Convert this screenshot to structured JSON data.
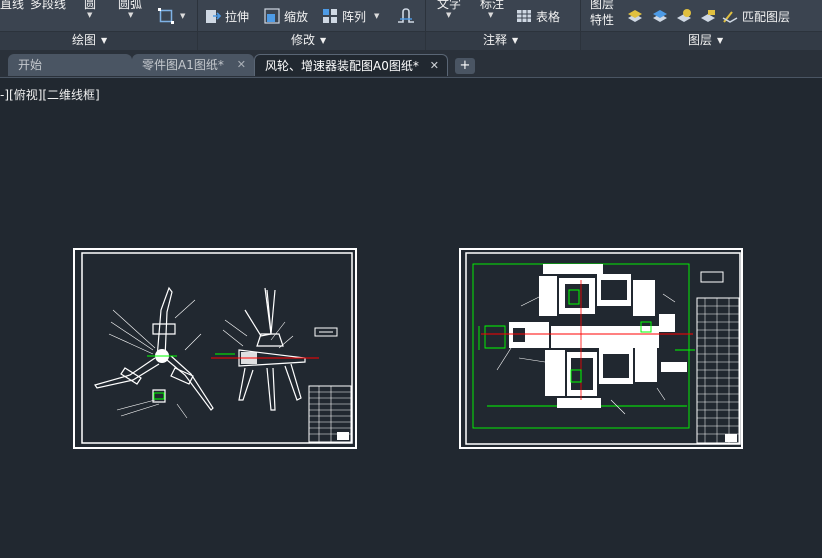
{
  "ribbon": {
    "draw_panel": {
      "title": "绘图",
      "line_label": "直线",
      "polyline_label": "多段线",
      "circle_label": "圆",
      "arc_label": "圆弧"
    },
    "modify_panel": {
      "title": "修改",
      "stretch_label": "拉伸",
      "scale_label": "缩放",
      "array_label": "阵列"
    },
    "annotation_panel": {
      "title": "注释",
      "text_label": "文字",
      "dimension_label": "标注",
      "table_label": "表格"
    },
    "layers_panel": {
      "title": "图层",
      "layer_properties_label_1": "图层",
      "layer_properties_label_2": "特性",
      "match_layer_label": "匹配图层"
    }
  },
  "tabs": [
    {
      "label": "开始",
      "active": false
    },
    {
      "label": "零件图A1图纸*",
      "active": false
    },
    {
      "label": "风轮、增速器装配图A0图纸*",
      "active": true
    }
  ],
  "new_tab_label": "+",
  "close_glyph": "✕",
  "viewport": {
    "label": "-][俯视][二维线框]"
  },
  "colors": {
    "background": "#212830",
    "ribbon": "#3b4450",
    "drawing_line": "#ffffff",
    "dimension_green": "#00ff00",
    "centerline_red": "#ff0000"
  },
  "icons": [
    "rectangle-icon",
    "stretch-icon",
    "scale-icon",
    "array-icon",
    "join-icon",
    "table-icon",
    "layer-states-icon",
    "match-layer-icon"
  ]
}
